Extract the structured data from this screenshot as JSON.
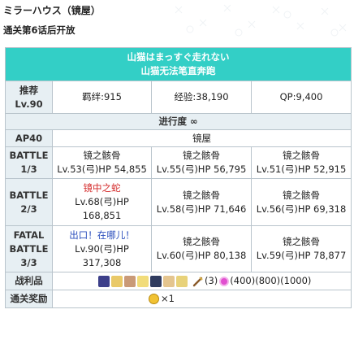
{
  "section_title": "ミラーハウス（镜屋）",
  "unlock_text": "通关第6话后开放",
  "quest": {
    "name_jp": "山猫はまっすぐ走れない",
    "name_cn": "山猫无法笔直奔跑",
    "recommend_label": "推荐",
    "recommend_level": "Lv.90",
    "bond": "羁绊:915",
    "exp": "经验:38,190",
    "qp": "QP:9,400",
    "progress": "进行度 ∞",
    "ap": "AP40",
    "location": "镜屋",
    "battles": [
      {
        "label1": "BATTLE",
        "label2": "1/3",
        "enemies": [
          {
            "name": "镜之骸骨",
            "stats": "Lv.53(弓)HP 54,855"
          },
          {
            "name": "镜之骸骨",
            "stats": "Lv.55(弓)HP 56,795"
          },
          {
            "name": "镜之骸骨",
            "stats": "Lv.51(弓)HP 52,915"
          }
        ]
      },
      {
        "label1": "BATTLE",
        "label2": "2/3",
        "enemies": [
          {
            "name": "镜中之蛇",
            "stats": "Lv.68(弓)HP",
            "hp": "168,851"
          },
          {
            "name": "镜之骸骨",
            "stats": "Lv.58(弓)HP 71,646"
          },
          {
            "name": "镜之骸骨",
            "stats": "Lv.56(弓)HP 69,318"
          }
        ]
      },
      {
        "label0": "FATAL",
        "label1": "BATTLE",
        "label2": "3/3",
        "enemies": [
          {
            "name": "出口！在哪儿！",
            "stats": "Lv.90(弓)HP",
            "hp": "317,308"
          },
          {
            "name": "镜之骸骨",
            "stats": "Lv.60(弓)HP 80,138"
          },
          {
            "name": "镜之骸骨",
            "stats": "Lv.59(弓)HP 78,877"
          }
        ]
      }
    ],
    "loot_label": "战利品",
    "loot_icons": [
      "material-icon",
      "material-icon",
      "material-icon",
      "material-icon",
      "material-icon",
      "material-icon",
      "material-icon"
    ],
    "loot_text1": "(3)",
    "loot_text2": "(400)(800)(1000)",
    "reward_label": "通关奖励",
    "reward_text": "×1",
    "colors": {
      "banner": "#33cfc6",
      "label_bg": "#e7eff3",
      "border": "#b9c4cc",
      "red": "#d42a2a",
      "blue": "#2c4fbd"
    }
  }
}
